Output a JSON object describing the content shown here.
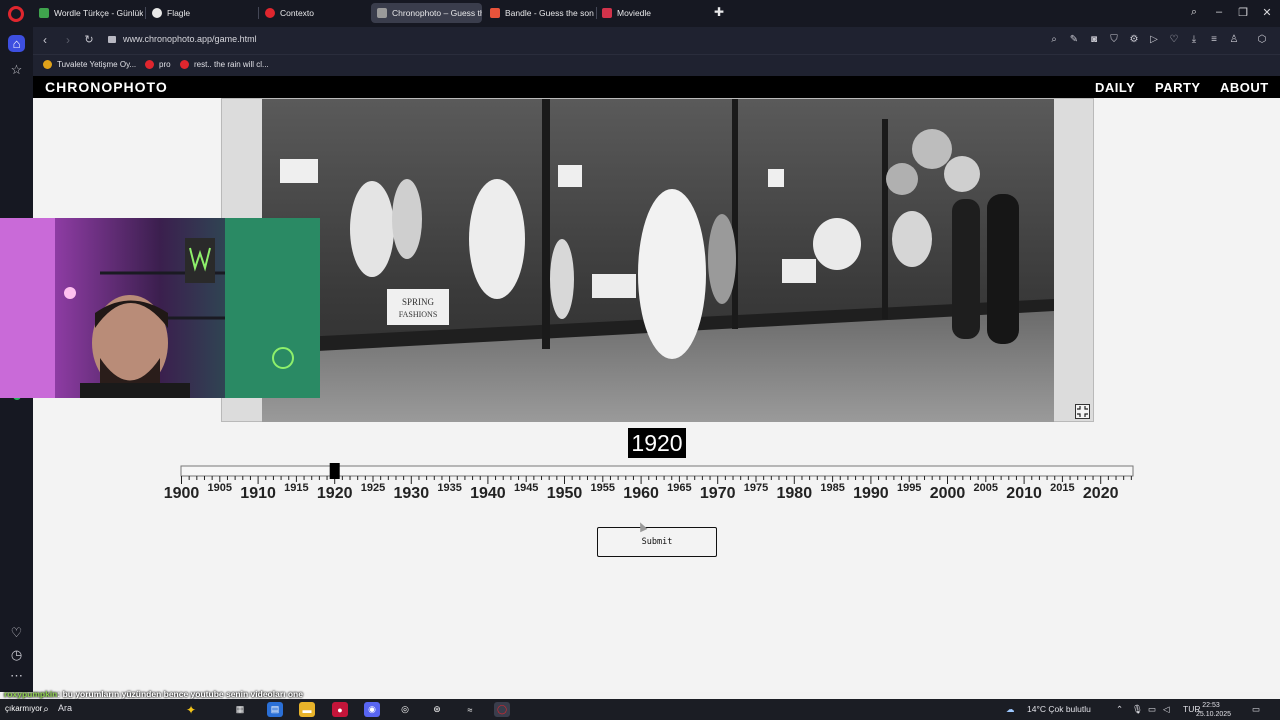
{
  "browser": {
    "tabs": [
      {
        "label": "Wordle Türkçe - Günlük K",
        "color": "#3fa34d",
        "active": false
      },
      {
        "label": "Flagle",
        "color": "#e9e9e9",
        "active": false
      },
      {
        "label": "Contexto",
        "color": "#e0262e",
        "active": false
      },
      {
        "label": "Chronophoto – Guess the",
        "color": "#9a9a9a",
        "active": true
      },
      {
        "label": "Bandle - Guess the song, ",
        "color": "#e8533b",
        "active": false
      },
      {
        "label": "Moviedle",
        "color": "#d2334b",
        "active": false
      }
    ],
    "url": "www.chronophoto.app/game.html",
    "bookmarks": [
      {
        "label": "Tuvalete Yetişme Oy...",
        "color": "#e0a21a"
      },
      {
        "label": "pro",
        "color": "#e0262e"
      },
      {
        "label": "rest.. the rain will cl...",
        "color": "#e0262e"
      }
    ]
  },
  "site": {
    "logo": "CHRONOPHOTO",
    "nav": {
      "daily": "DAILY",
      "party": "PARTY",
      "about": "ABOUT"
    },
    "photo_subject": "vintage-shop-window-spring-fashions",
    "photo_signs": {
      "sign1": "SPRING",
      "sign2": "FASHIONS"
    },
    "selected_year": "1920",
    "submit_label": "Submit",
    "slider": {
      "min": 1900,
      "max": 2024,
      "value": 1920
    },
    "major_ticks": [
      "1900",
      "1910",
      "1920",
      "1930",
      "1940",
      "1950",
      "1960",
      "1970",
      "1980",
      "1990",
      "2000",
      "2010",
      "2020"
    ],
    "minor_ticks": [
      "1905",
      "1915",
      "1925",
      "1935",
      "1945",
      "1955",
      "1965",
      "1975",
      "1985",
      "1995",
      "2005",
      "2015"
    ]
  },
  "overlay": {
    "chat_user": "roxypumpkin",
    "chat_message": ": bu yorumların yüzünden bence youtube senin videoları one"
  },
  "taskbar": {
    "start_label": "çıkarmıyor",
    "search_label": "Ara",
    "weather": "14°C  Çok bulutlu",
    "language": "TUR",
    "time": "22:53",
    "date": "25.10.2025"
  },
  "colors": {
    "accent": "#3d4fe0",
    "brand": "#e0262e"
  }
}
